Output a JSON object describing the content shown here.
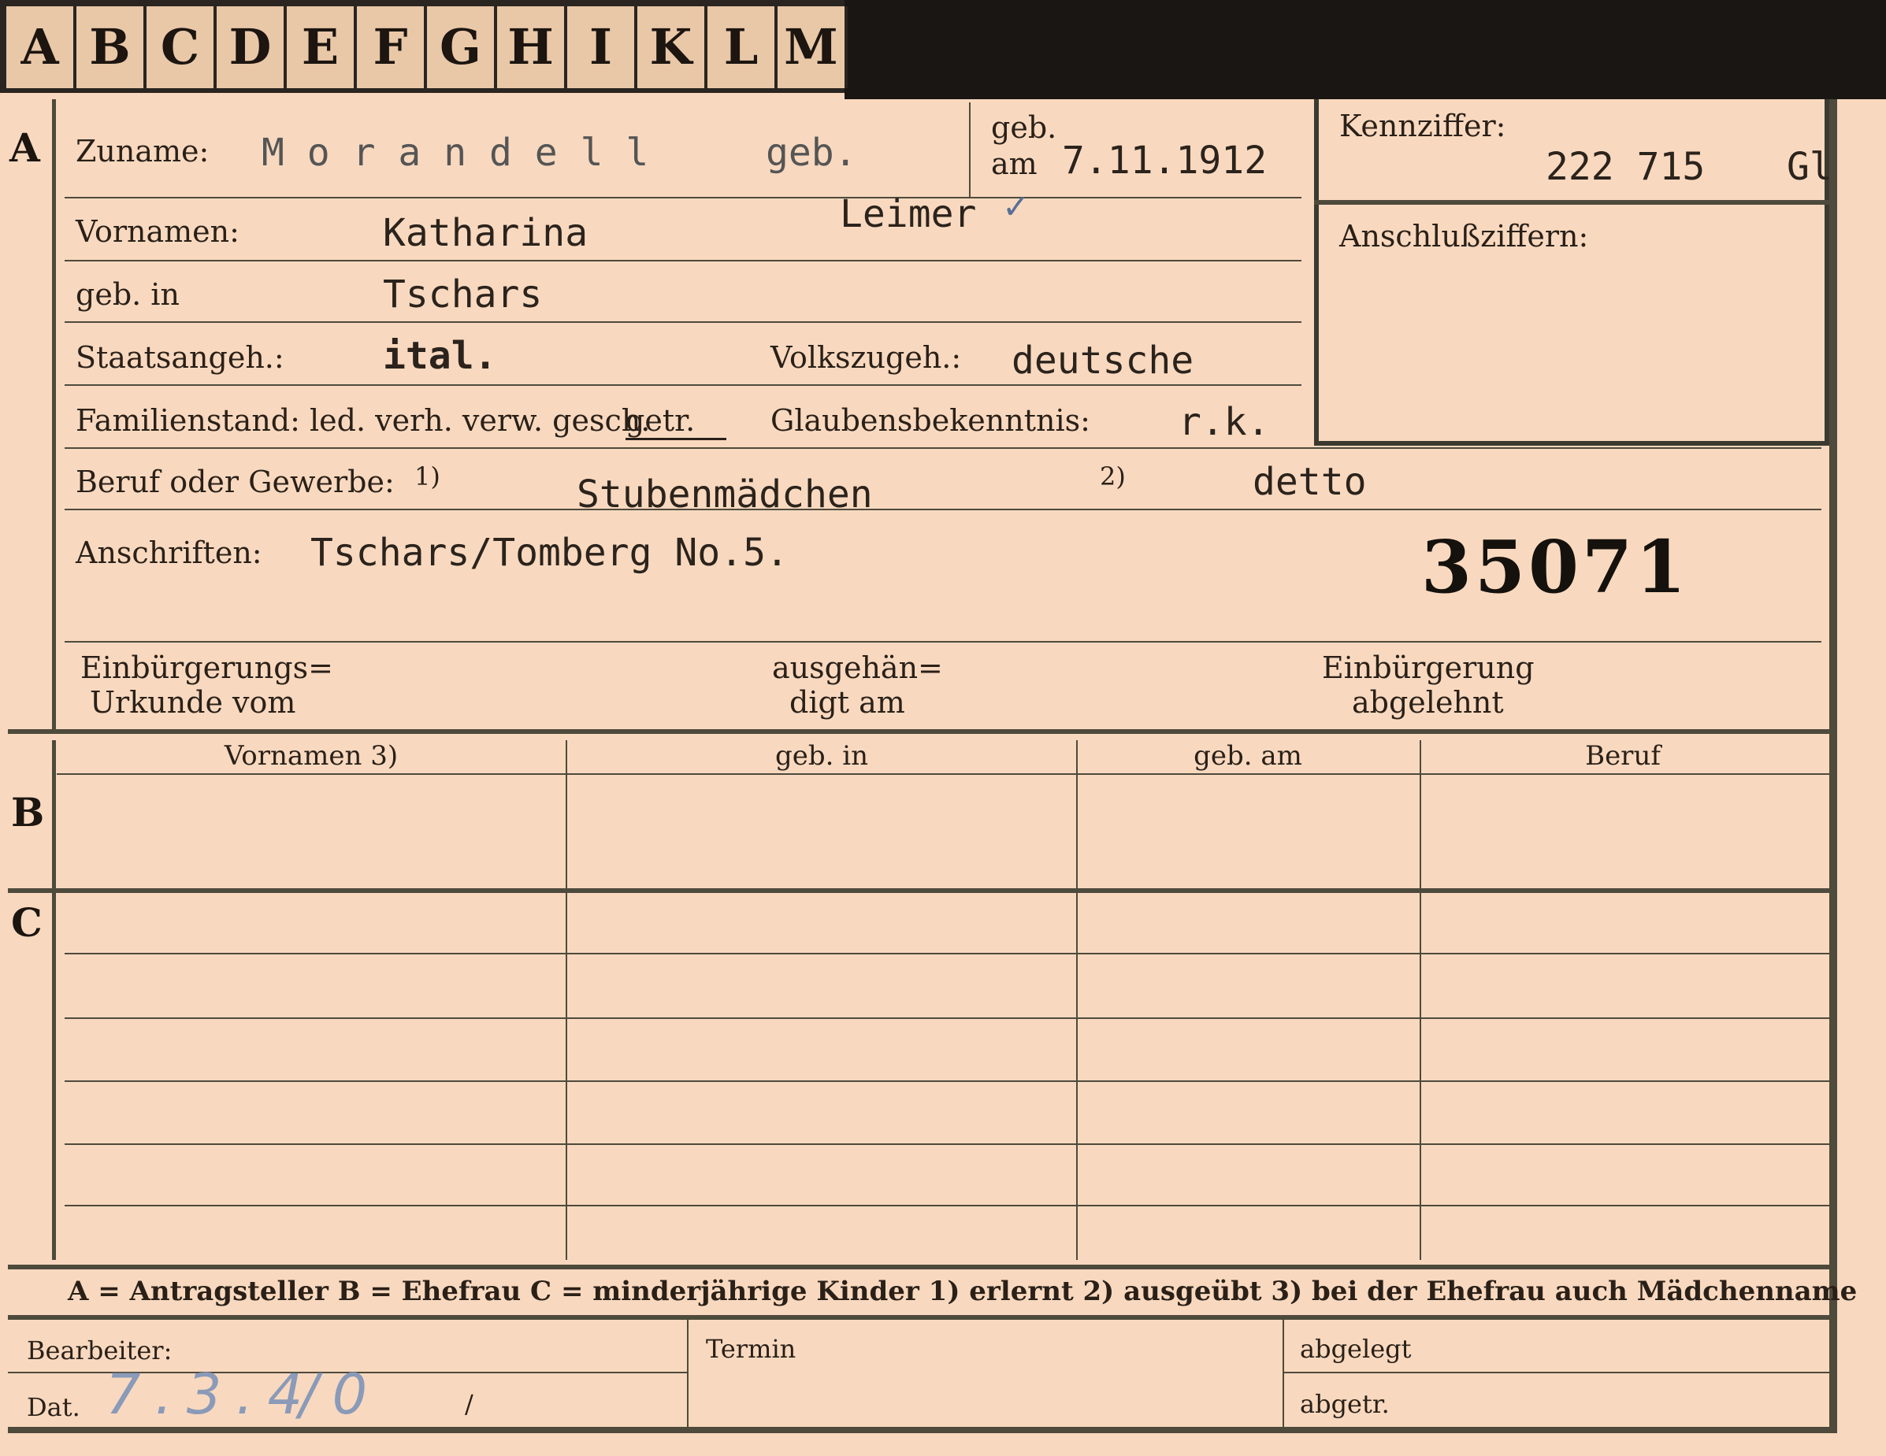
{
  "tabs": [
    "A",
    "B",
    "C",
    "D",
    "E",
    "F",
    "G",
    "H",
    "I",
    "K",
    "L",
    "M"
  ],
  "section_a": {
    "side_letter": "A",
    "zuname_label": "Zuname:",
    "zuname_value": "M o r a n d e l l",
    "geb_label": "geb.",
    "geb_am_label_1": "geb.",
    "geb_am_label_2": "am",
    "geb_am_value": "7.11.1912",
    "maiden_name": "Leimer",
    "check_mark": "✓",
    "kennziffer_label": "Kennziffer:",
    "kennziffer_value": "222 715",
    "kennziffer_suffix": "Gl",
    "anschluss_label": "Anschlußziffern:",
    "vornamen_label": "Vornamen:",
    "vornamen_value": "Katharina",
    "geb_in_label": "geb. in",
    "geb_in_value": "Tschars",
    "staatsangeh_label": "Staatsangeh.:",
    "staatsangeh_value": "ital.",
    "volkszugeh_label": "Volkszugeh.:",
    "volkszugeh_value": "deutsche",
    "familienstand_label": "Familienstand: led. verh. verw. gesch.",
    "familienstand_value": "getr.",
    "glaubens_label": "Glaubensbekenntnis:",
    "glaubens_value": "r.k.",
    "beruf_label": "Beruf oder Gewerbe:",
    "beruf_note1": "1)",
    "beruf_value1": "Stubenmädchen",
    "beruf_note2": "2)",
    "beruf_value2": "detto",
    "anschriften_label": "Anschriften:",
    "anschriften_value": "Tschars/Tomberg No.5.",
    "stamp_number": "35071",
    "einbuergerung_urkunde_1": "Einbürgerungs=",
    "einbuergerung_urkunde_2": "Urkunde vom",
    "ausgehaendigt_1": "ausgehän=",
    "ausgehaendigt_2": "digt am",
    "abgelehnt_1": "Einbürgerung",
    "abgelehnt_2": "abgelehnt"
  },
  "section_b": {
    "side_letter": "B",
    "columns": [
      "Vornamen 3)",
      "geb. in",
      "geb. am",
      "Beruf"
    ]
  },
  "section_c": {
    "side_letter": "C"
  },
  "legend": "A = Antragsteller   B = Ehefrau   C = minderjährige Kinder   1) erlernt   2) ausgeübt   3) bei der Ehefrau auch Mädchenname",
  "footer": {
    "bearbeiter_label": "Bearbeiter:",
    "dat_label": "Dat.",
    "dat_value": "7.3.4",
    "dat_slash1": "/0",
    "dat_slash2": "/",
    "termin_label": "Termin",
    "abgelegt_label": "abgelegt",
    "abgetr_label": "abgetr."
  }
}
